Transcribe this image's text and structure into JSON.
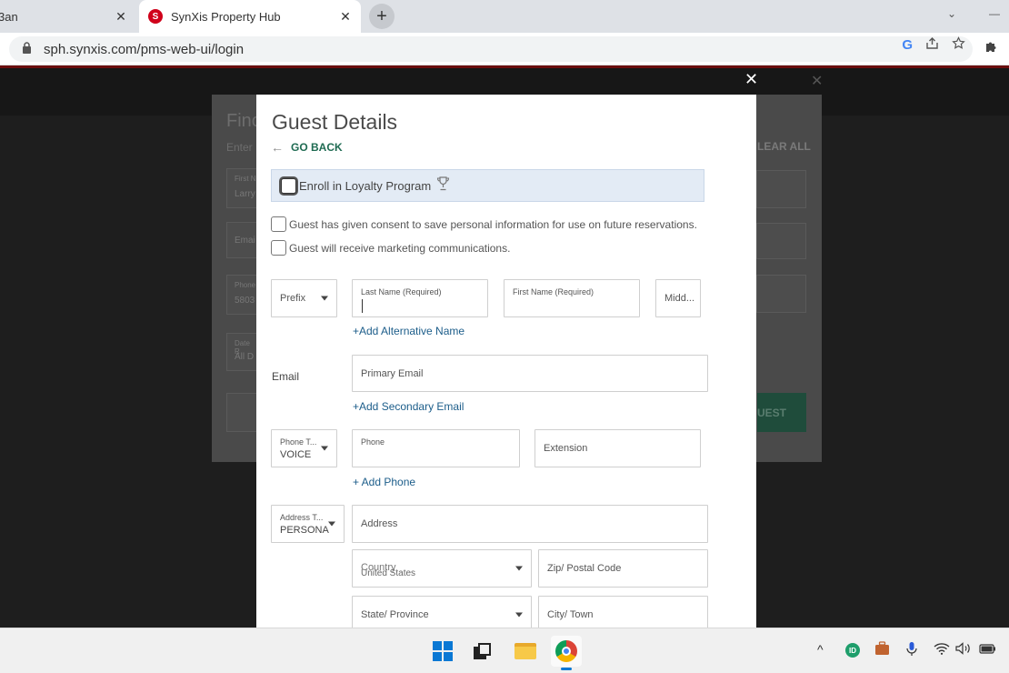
{
  "browser": {
    "tabs": [
      {
        "title": "3an",
        "close": "✕"
      },
      {
        "title": "SynXis Property Hub",
        "close": "✕",
        "favicon_letter": "S"
      }
    ],
    "new_tab": "+",
    "url": "sph.synxis.com/pms-web-ui/login",
    "minimize": "—",
    "dropdown": "⌄"
  },
  "background_dialog": {
    "title": "Finc",
    "subtitle": "Enter",
    "clear_all": "LEAR ALL",
    "button_partial": "UEST",
    "field_fragments": [
      "First N",
      "Larry",
      "Emai",
      "Phone",
      "5803",
      "Date R",
      "All D"
    ]
  },
  "modal": {
    "close": "✕",
    "title": "Guest Details",
    "go_back": "GO BACK",
    "loyalty_label": "Enroll in Loyalty Program",
    "consent_label": "Guest has given consent to save personal information for use on future reservations.",
    "marketing_label": "Guest will receive marketing communications.",
    "prefix_label": "Prefix",
    "last_name_label": "Last Name (Required)",
    "first_name_label": "First Name (Required)",
    "middle_label": "Midd...",
    "add_alt_name": "+Add Alternative Name",
    "email_label": "Email",
    "primary_email": "Primary Email",
    "add_secondary_email": "+Add Secondary Email",
    "phone_type_label": "Phone T...",
    "phone_type_value": "VOICE",
    "phone_label": "Phone",
    "extension_label": "Extension",
    "add_phone": "+ Add Phone",
    "address_type_label": "Address T...",
    "address_type_value": "PERSONA",
    "address_label": "Address",
    "country_label": "Country",
    "country_value": "United States",
    "zip_label": "Zip/ Postal Code",
    "state_label": "State/ Province",
    "city_label": "City/ Town"
  },
  "colors": {
    "accent_green": "#1f6b52",
    "link_blue": "#1c5d8a",
    "loyalty_bg": "#e3ebf5",
    "brand_red": "#d0021b"
  },
  "taskbar": {
    "apps": [
      "windows-start",
      "tv-app",
      "file-explorer",
      "chrome"
    ],
    "tray": {
      "chevron": "^",
      "badge": "ID"
    }
  }
}
